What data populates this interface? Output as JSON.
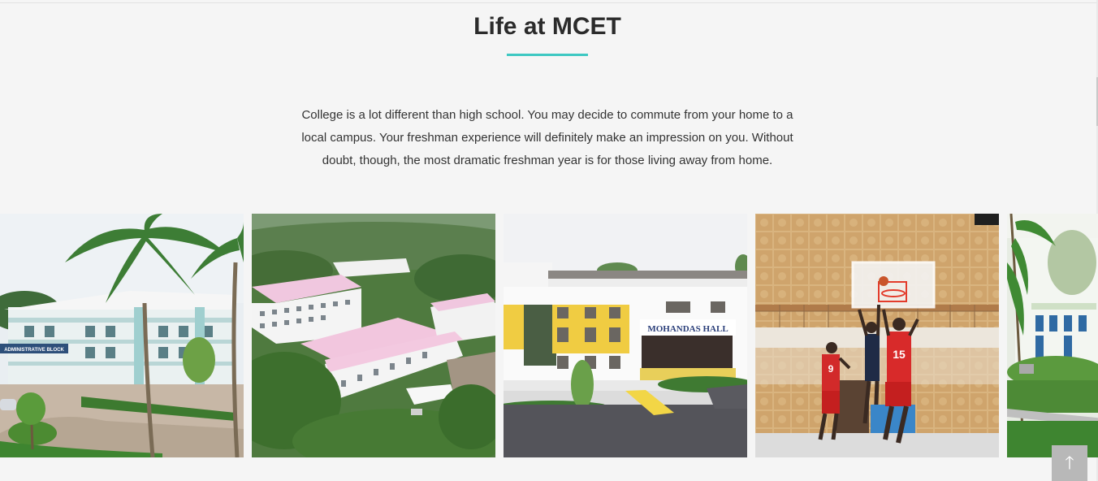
{
  "section": {
    "title": "Life at MCET",
    "intro": "College is a lot different than high school. You may decide to commute from your home to a local campus. Your freshman experience will definitely make an impression on you. Without doubt, though, the most dramatic freshman year is for those living away from home."
  },
  "gallery": {
    "photos": [
      {
        "sign": "ADMINISTRATIVE BLOCK"
      },
      {
        "sign": ""
      },
      {
        "sign": "MOHANDAS HALL"
      },
      {
        "sign": "",
        "jerseys": [
          "9",
          "15"
        ]
      },
      {
        "sign": ""
      }
    ]
  },
  "scroll_top": {
    "icon": "arrow-up-icon",
    "glyph": "🡑"
  },
  "colors": {
    "accent": "#3ec8c2",
    "background": "#f5f5f5"
  }
}
